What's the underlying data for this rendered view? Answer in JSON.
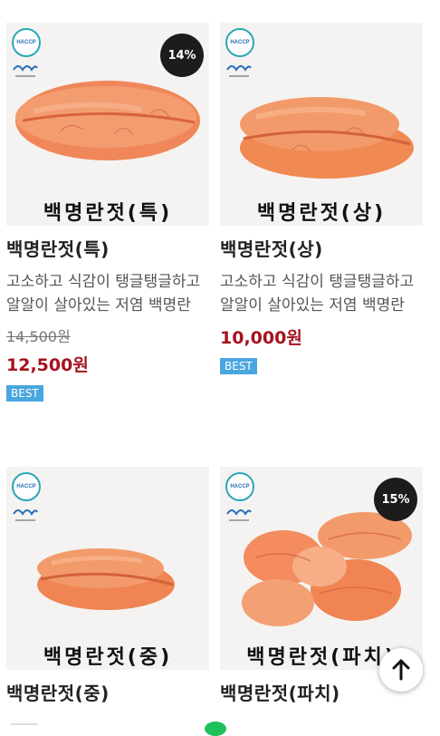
{
  "products": [
    {
      "image_caption": "백명란젓(특)",
      "name": "백명란젓(특)",
      "description": "고소하고 식감이 탱글탱글하고 알알이 살아있는 저염 백명란",
      "original_price": "14,500원",
      "price": "12,500원",
      "discount": "14%",
      "badge": "BEST",
      "haccp_label": "HACCP"
    },
    {
      "image_caption": "백명란젓(상)",
      "name": "백명란젓(상)",
      "description": "고소하고 식감이 탱글탱글하고 알알이 살아있는 저염 백명란",
      "price": "10,000원",
      "badge": "BEST",
      "haccp_label": "HACCP"
    },
    {
      "image_caption": "백명란젓(중)",
      "name": "백명란젓(중)",
      "haccp_label": "HACCP"
    },
    {
      "image_caption": "백명란젓(파치)",
      "name": "백명란젓(파치)",
      "discount": "15%",
      "haccp_label": "HACCP"
    }
  ],
  "icons": {
    "scroll_top": "arrow-up-icon",
    "certification": "haccp-icon",
    "brand": "wave-logo-icon",
    "discount": "discount-badge"
  },
  "colors": {
    "price": "#a4131f",
    "badge": "#4aa6df",
    "discount_bg": "#1c1c1c",
    "roe": "#f08a5a"
  }
}
